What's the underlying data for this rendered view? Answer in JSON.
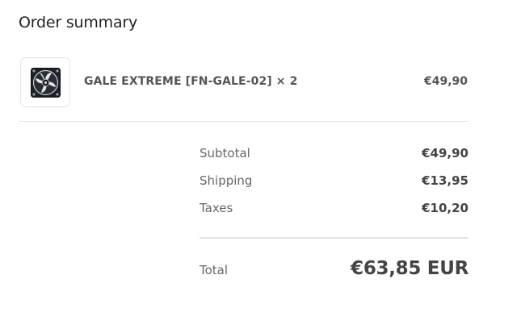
{
  "order_summary": {
    "title": "Order summary",
    "items": [
      {
        "name": "GALE EXTREME [FN-GALE-02] × 2",
        "price": "€49,90",
        "image_icon": "fan-icon"
      }
    ],
    "subtotal": {
      "label": "Subtotal",
      "value": "€49,90"
    },
    "shipping": {
      "label": "Shipping",
      "value": "€13,95"
    },
    "taxes": {
      "label": "Taxes",
      "value": "€10,20"
    },
    "total": {
      "label": "Total",
      "value": "€63,85 EUR"
    }
  }
}
